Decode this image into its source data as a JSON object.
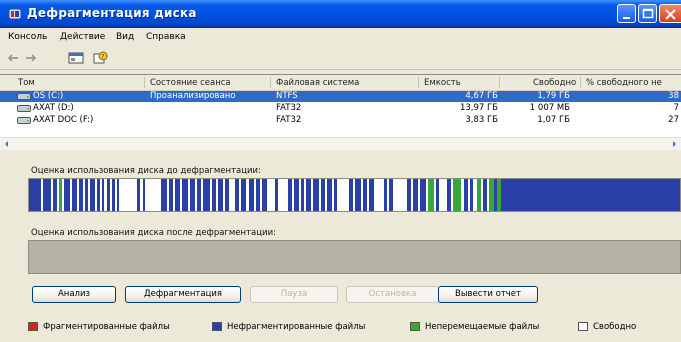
{
  "window": {
    "title": "Дефрагментация диска"
  },
  "menu": [
    "Консоль",
    "Действие",
    "Вид",
    "Справка"
  ],
  "toolbar": {
    "icons": [
      "back-arrow-icon",
      "forward-arrow-icon",
      "console-view-icon",
      "properties-help-icon"
    ]
  },
  "table": {
    "columns": [
      "Том",
      "Состояние сеанса",
      "Файловая система",
      "Емкость",
      "Свободно",
      "% свободного не"
    ],
    "rows": [
      {
        "volume": "OS (C:)",
        "status": "Проанализировано",
        "fs": "NTFS",
        "capacity": "4,67 ГБ",
        "free": "1,79 ГБ",
        "pct": "38",
        "selected": true
      },
      {
        "volume": "AXAT (D:)",
        "status": "",
        "fs": "FAT32",
        "capacity": "13,97 ГБ",
        "free": "1 007 МБ",
        "pct": "7",
        "selected": false
      },
      {
        "volume": "AXAT DOC (F:)",
        "status": "",
        "fs": "FAT32",
        "capacity": "3,83 ГБ",
        "free": "1,07 ГБ",
        "pct": "27",
        "selected": false
      }
    ]
  },
  "analysis": {
    "before_label": "Оценка использования диска до дефрагментации:",
    "after_label": "Оценка использования диска после дефрагментации:"
  },
  "buttons": {
    "analyze": "Анализ",
    "defragment": "Дефрагментация",
    "pause": "Пауза",
    "stop": "Остановка",
    "report": "Вывести отчет"
  },
  "legend": [
    {
      "label": "Фрагментированные файлы",
      "color": "#e02020"
    },
    {
      "label": "Нефрагментированные файлы",
      "color": "#2b3fa8"
    },
    {
      "label": "Неперемещаемые файлы",
      "color": "#35a83a"
    },
    {
      "label": "Свободно",
      "color": "#ffffff"
    }
  ],
  "colors": {
    "fragmented": "#e02020",
    "contiguous": "#2b3fa8",
    "unmovable": "#35a83a",
    "free": "#ffffff",
    "selection": "#316ac5"
  }
}
